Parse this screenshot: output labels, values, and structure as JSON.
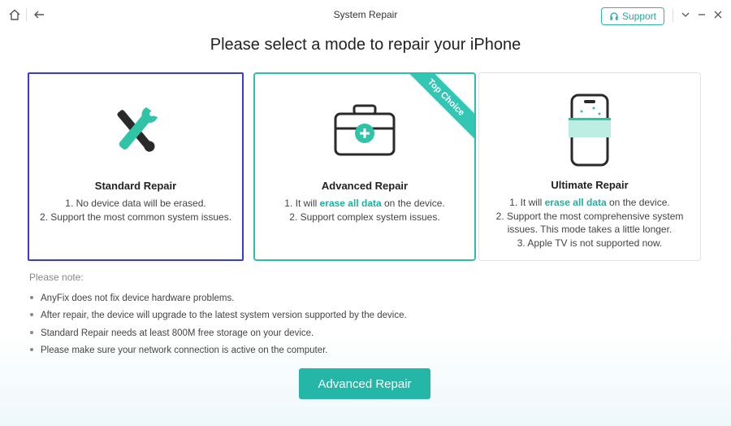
{
  "window": {
    "title": "System Repair",
    "support_label": "Support"
  },
  "heading": "Please select a mode to repair your iPhone",
  "cards": [
    {
      "title": "Standard Repair",
      "lines": [
        "1. No device data will be erased.",
        "2. Support the most common system issues."
      ],
      "icon": "wrench-screwdriver-icon",
      "selected": true
    },
    {
      "title": "Advanced Repair",
      "line1_pre": "1. It will ",
      "line1_hl": "erase all data",
      "line1_post": " on the device.",
      "line2": "2. Support complex system issues.",
      "ribbon": "Top Choice",
      "icon": "toolbox-icon"
    },
    {
      "title": "Ultimate Repair",
      "line1_pre": "1. It will ",
      "line1_hl": "erase all data",
      "line1_post": " on the device.",
      "line2": "2. Support the most comprehensive system issues. This mode takes a little longer.",
      "line3": "3. Apple TV is not supported now.",
      "icon": "phone-scan-icon"
    }
  ],
  "note": {
    "title": "Please note:",
    "items": [
      "AnyFix does not fix device hardware problems.",
      "After repair, the device will upgrade to the latest system version supported by the device.",
      "Standard Repair needs at least 800M free storage on your device.",
      "Please make sure your network connection is active on the computer."
    ]
  },
  "primary_button": "Advanced Repair",
  "colors": {
    "accent": "#24b6a6",
    "selected_border": "#3a3ccf",
    "highlight": "#1fb0a0"
  }
}
